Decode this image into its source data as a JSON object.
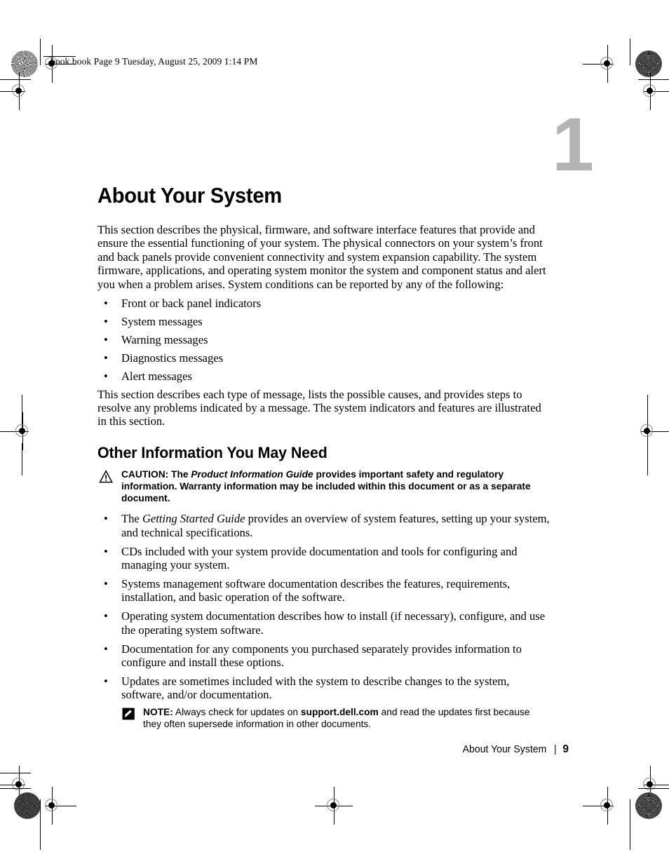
{
  "slug": {
    "text": "book.book  Page 9  Tuesday, August 25, 2009  1:14 PM"
  },
  "chapter": {
    "number": "1",
    "number_color": "#b4b4b4",
    "title": "About Your System"
  },
  "intro": {
    "paragraph": "This section describes the physical, firmware, and software interface features that provide and ensure the essential functioning of your system. The physical connectors on your system’s front and back panels provide convenient connectivity and system expansion capability. The system firmware, applications, and operating system monitor the system and component status and alert you when a problem arises. System conditions can be reported by any of the following:"
  },
  "condition_list": {
    "bullet_glyph": "•",
    "items": [
      "Front or back panel indicators",
      "System messages",
      "Warning messages",
      "Diagnostics messages",
      "Alert messages"
    ]
  },
  "after_list": {
    "paragraph": "This section describes each type of message, lists the possible causes, and provides steps to resolve any problems indicated by a message. The system indicators and features are illustrated in this section."
  },
  "other_info": {
    "heading": "Other Information You May Need",
    "caution": {
      "icon": "warning-triangle-icon",
      "lead": "CAUTION:",
      "text_before": " The ",
      "italic_ref": "Product Information Guide",
      "text_after": " provides important safety and regulatory information. Warranty information may be included within this document or as a separate document."
    },
    "bullet_glyph": "•",
    "items": [
      {
        "text_before": "The ",
        "italic_ref": "Getting Started Guide",
        "text_after": " provides an overview of system features, setting up your system, and technical specifications."
      },
      {
        "text_before": "CDs included with your system provide documentation and tools for configuring and managing your system.",
        "italic_ref": "",
        "text_after": ""
      },
      {
        "text_before": "Systems management software documentation describes the features, requirements, installation, and basic operation of the software.",
        "italic_ref": "",
        "text_after": ""
      },
      {
        "text_before": "Operating system documentation describes how to install (if necessary), configure, and use the operating system software.",
        "italic_ref": "",
        "text_after": ""
      },
      {
        "text_before": "Documentation for any components you purchased separately provides information to configure and install these options.",
        "italic_ref": "",
        "text_after": ""
      },
      {
        "text_before": "Updates are sometimes included with the system to describe changes to the system, software, and/or documentation.",
        "italic_ref": "",
        "text_after": ""
      }
    ],
    "note": {
      "icon": "pencil-note-icon",
      "lead": "NOTE:",
      "text_before": " Always check for updates on ",
      "bold_ref": "support.dell.com",
      "text_after": " and read the updates first because they often supersede information in other documents."
    }
  },
  "footer": {
    "chapter_label": "About Your System",
    "separator": "|",
    "page_number": "9"
  }
}
